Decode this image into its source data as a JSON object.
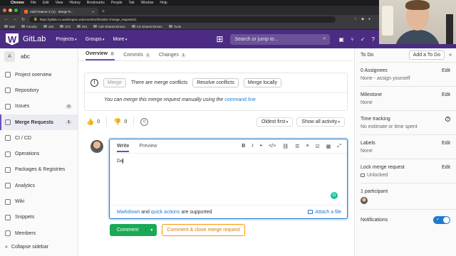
{
  "macbar": {
    "app": "Chrome",
    "menus": [
      "File",
      "Edit",
      "View",
      "History",
      "Bookmarks",
      "People",
      "Tab",
      "Window",
      "Help"
    ]
  },
  "browser": {
    "tab_title": "Add Feature X (1) · Merge R...",
    "url": "https://gitlab.cs.washington.edu/cse291/2bs/abc/-/merge_requests/1",
    "bookmarks": [
      "Mail",
      "Faculty",
      "163",
      "373",
      "391",
      "UW Shared Drives",
      "CS Shared Drives",
      "Tools"
    ]
  },
  "header": {
    "brand": "GitLab",
    "nav": [
      "Projects",
      "Groups",
      "More"
    ],
    "search_placeholder": "Search or jump to..."
  },
  "project": {
    "initial": "A",
    "name": "abc"
  },
  "sidebar": {
    "items": [
      {
        "label": "Project overview",
        "icon": "home-icon",
        "badge": ""
      },
      {
        "label": "Repository",
        "icon": "doc-icon",
        "badge": ""
      },
      {
        "label": "Issues",
        "icon": "issues-icon",
        "badge": "0"
      },
      {
        "label": "Merge Requests",
        "icon": "merge-request-icon",
        "badge": "1"
      },
      {
        "label": "CI / CD",
        "icon": "rocket-icon",
        "badge": ""
      },
      {
        "label": "Operations",
        "icon": "cloud-icon",
        "badge": ""
      },
      {
        "label": "Packages & Registries",
        "icon": "package-icon",
        "badge": ""
      },
      {
        "label": "Analytics",
        "icon": "chart-icon",
        "badge": ""
      },
      {
        "label": "Wiki",
        "icon": "book-icon",
        "badge": ""
      },
      {
        "label": "Snippets",
        "icon": "snippet-icon",
        "badge": ""
      },
      {
        "label": "Members",
        "icon": "users-icon",
        "badge": ""
      }
    ],
    "collapse": "Collapse sidebar"
  },
  "tabs": [
    {
      "label": "Overview",
      "count": "0"
    },
    {
      "label": "Commits",
      "count": "1"
    },
    {
      "label": "Changes",
      "count": "1"
    }
  ],
  "conflict": {
    "merge_label": "Merge",
    "message": "There are merge conflicts",
    "resolve": "Resolve conflicts",
    "merge_locally": "Merge locally",
    "hint": "You can merge this merge request manually using the",
    "hint_link": "command line"
  },
  "reactions": {
    "up": "0",
    "down": "0",
    "sort": "Oldest first",
    "filter": "Show all activity"
  },
  "editor": {
    "tab_write": "Write",
    "tab_preview": "Preview",
    "text": "De",
    "footer_link1": "Markdown",
    "footer_and": "and",
    "footer_link2": "quick actions",
    "footer_tail": "are supported",
    "attach": "Attach a file"
  },
  "actions": {
    "comment": "Comment",
    "close": "Comment & close merge request"
  },
  "right": {
    "todo": "To Do",
    "add_todo": "Add a To Do",
    "assignees": "0 Assignees",
    "assign_self": "None - assign yourself",
    "milestone": "Milestone",
    "milestone_val": "None",
    "time": "Time tracking",
    "time_val": "No estimate or time spent",
    "labels": "Labels",
    "labels_val": "None",
    "lock": "Lock merge request",
    "lock_val": "Unlocked",
    "participants": "1 participant",
    "notifications": "Notifications",
    "edit": "Edit"
  },
  "colors": {
    "brand": "#4b2c82",
    "accent": "#6b4fbb",
    "link": "#1f78d1",
    "success": "#1aaa55",
    "warning": "#fc9403"
  }
}
